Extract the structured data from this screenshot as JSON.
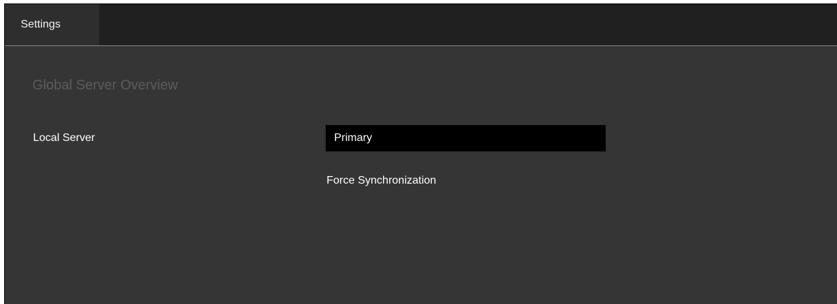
{
  "tabs": [
    {
      "label": "Settings"
    }
  ],
  "section": {
    "title": "Global Server Overview"
  },
  "local_server": {
    "label": "Local Server",
    "selected_value": "Primary"
  },
  "actions": {
    "force_sync_label": "Force Synchronization"
  },
  "colors": {
    "tabbar_bg": "#202020",
    "active_tab_bg": "#2e2e2e",
    "panel_bg": "#353535",
    "title_text": "#5c5c5c",
    "select_bg": "#000000",
    "text": "#ffffff"
  }
}
